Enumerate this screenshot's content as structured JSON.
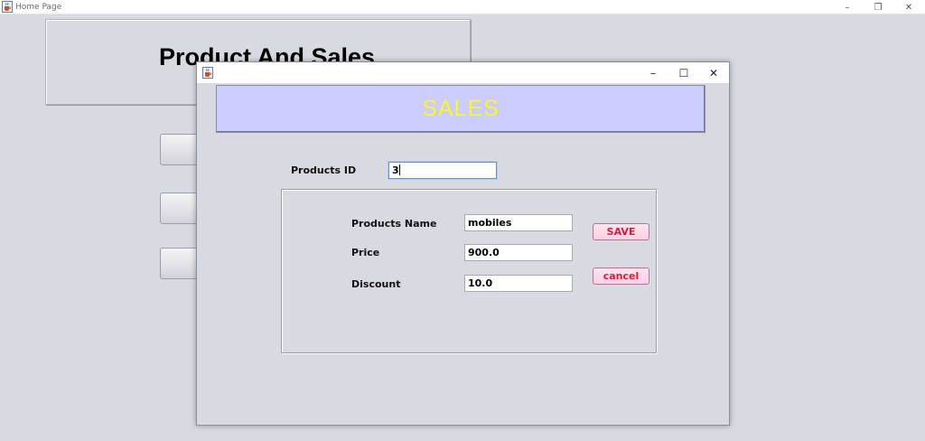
{
  "main_window": {
    "title": "Home Page",
    "heading": "Product And Sales",
    "controls": {
      "minimize": "–",
      "restore": "❐",
      "close": "✕"
    }
  },
  "dialog": {
    "controls": {
      "minimize": "–",
      "maximize": "☐",
      "close": "✕"
    },
    "banner": "SALES",
    "products_id": {
      "label": "Products ID",
      "value": "3"
    },
    "products_name": {
      "label": "Products Name",
      "value": "mobiles"
    },
    "price": {
      "label": "Price",
      "value": "900.0"
    },
    "discount": {
      "label": "Discount",
      "value": "10.0"
    },
    "save_label": "SAVE",
    "cancel_label": "cancel"
  },
  "colors": {
    "banner_bg": "#ccccff",
    "banner_text": "#f5f548",
    "button_text": "#d02040",
    "button_bg": "#ffd8ea"
  },
  "icons": {
    "app_icon": "java-coffee-cup-icon"
  }
}
